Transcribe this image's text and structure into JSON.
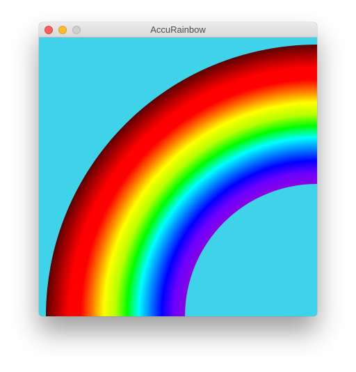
{
  "window": {
    "title": "AccuRainbow",
    "controls": [
      "close-button",
      "minimize-button",
      "zoom-button"
    ]
  },
  "canvas": {
    "background_color": "#3fd3ea",
    "rainbow_gradient": [
      "#5a0000",
      "#b00000",
      "#ff0000",
      "#ff0000",
      "#ff7a00",
      "#ffff00",
      "#b8ff00",
      "#00ff00",
      "#00ffff",
      "#0080ff",
      "#0000ff",
      "#6a00ff",
      "#8a00e0"
    ]
  }
}
